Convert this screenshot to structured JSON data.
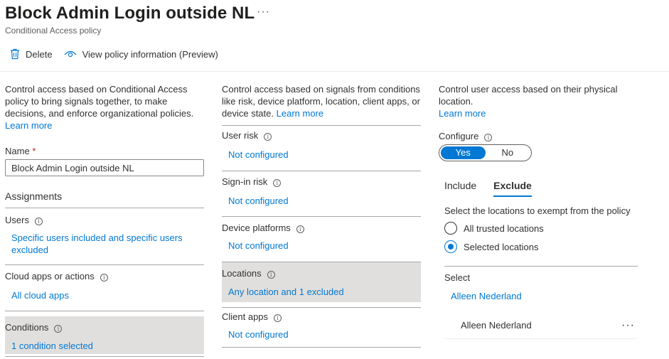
{
  "header": {
    "title": "Block Admin Login outside NL",
    "more": "···",
    "subtitle": "Conditional Access policy"
  },
  "toolbar": {
    "delete_label": "Delete",
    "view_info_label": "View policy information (Preview)"
  },
  "col1": {
    "description": "Control access based on Conditional Access policy to bring signals together, to make decisions, and enforce organizational policies.",
    "learn_more": "Learn more",
    "name_label": "Name",
    "name_required": "*",
    "name_value": "Block Admin Login outside NL",
    "assignments_heading": "Assignments",
    "items": [
      {
        "title": "Users",
        "value": "Specific users included and specific users excluded"
      },
      {
        "title": "Cloud apps or actions",
        "value": "All cloud apps"
      },
      {
        "title": "Conditions",
        "value": "1 condition selected"
      }
    ]
  },
  "col2": {
    "description": "Control access based on signals from conditions like risk, device platform, location, client apps, or device state.",
    "learn_more": "Learn more",
    "items": [
      {
        "title": "User risk",
        "value": "Not configured"
      },
      {
        "title": "Sign-in risk",
        "value": "Not configured"
      },
      {
        "title": "Device platforms",
        "value": "Not configured"
      },
      {
        "title": "Locations",
        "value": "Any location and 1 excluded"
      },
      {
        "title": "Client apps",
        "value": "Not configured"
      }
    ]
  },
  "col3": {
    "description": "Control user access based on their physical location.",
    "learn_more": "Learn more",
    "configure_label": "Configure",
    "toggle_yes": "Yes",
    "toggle_no": "No",
    "tabs": [
      "Include",
      "Exclude"
    ],
    "exempt_text": "Select the locations to exempt from the policy",
    "radio_all": "All trusted locations",
    "radio_selected": "Selected locations",
    "select_label": "Select",
    "select_link": "Alleen Nederland",
    "selected_item": "Alleen Nederland",
    "item_more": "···"
  },
  "colors": {
    "accent": "#0078d4",
    "highlight": "#e1dfdd",
    "required": "#a4262c"
  }
}
